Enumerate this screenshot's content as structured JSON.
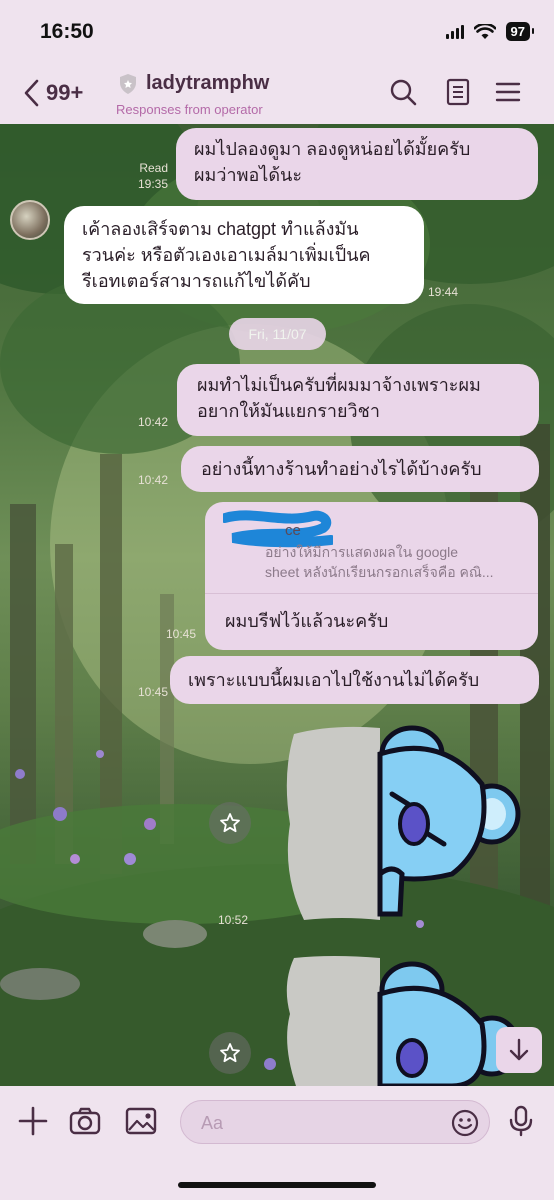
{
  "status": {
    "time": "16:50",
    "battery": "97"
  },
  "header": {
    "back_count": "99+",
    "chat_name": "ladytramphw",
    "subtitle": "Responses from operator"
  },
  "messages": {
    "m1": {
      "text_line1": "ผมไปลองดูมา ลองดูหน่อยได้มั้ยครับ",
      "text_line2": "ผมว่าพอได้นะ",
      "read": "Read",
      "time": "19:35"
    },
    "m2": {
      "text_line1": "เค้าลองเสิร์จตาม chatgpt ทำแล้งมัน",
      "text_line2": "รวนค่ะ หรือตัวเองเอาเมล์มาเพิ่มเป็นค",
      "text_line3": "รีเอทเตอร์สามารถแก้ไขได้คับ",
      "time": "19:44"
    },
    "date_separator": "Fri, 11/07",
    "m3": {
      "text_line1": "ผมทำไม่เป็นครับที่ผมมาจ้างเพราะผม",
      "text_line2": "อยากให้มันแยกรายวิชา",
      "time": "10:42"
    },
    "m4": {
      "text": "อย่างนี้ทางร้านทำอย่างไรได้บ้างครับ",
      "time": "10:42"
    },
    "m5": {
      "quote_name": "ce",
      "quote_line1": "อย่างให้มีการแสดงผลใน google",
      "quote_line2": "sheet หลังนักเรียนกรอกเสร็จคือ คณิ...",
      "text": "ผมบรีฟไว้แล้วนะครับ",
      "time": "10:45"
    },
    "m6": {
      "text": "เพราะแบบนี้ผมเอาไปใช้งานไม่ได้ครับ",
      "time": "10:45"
    },
    "sticker_time": "10:52"
  },
  "composer": {
    "placeholder": "Aa"
  },
  "icons": {
    "back": "chevron-left-icon",
    "shield": "shield-icon",
    "search": "search-icon",
    "notes": "notes-icon",
    "menu": "menu-icon",
    "plus": "plus-icon",
    "camera": "camera-icon",
    "image": "image-icon",
    "emoji": "emoji-icon",
    "mic": "microphone-icon",
    "star": "star-icon",
    "arrow_down": "arrow-down-icon"
  },
  "colors": {
    "bubble_out": "#ead6e9",
    "bubble_in": "#ffffff",
    "accent": "#b46aa8",
    "header_bg": "#efe3ee"
  }
}
